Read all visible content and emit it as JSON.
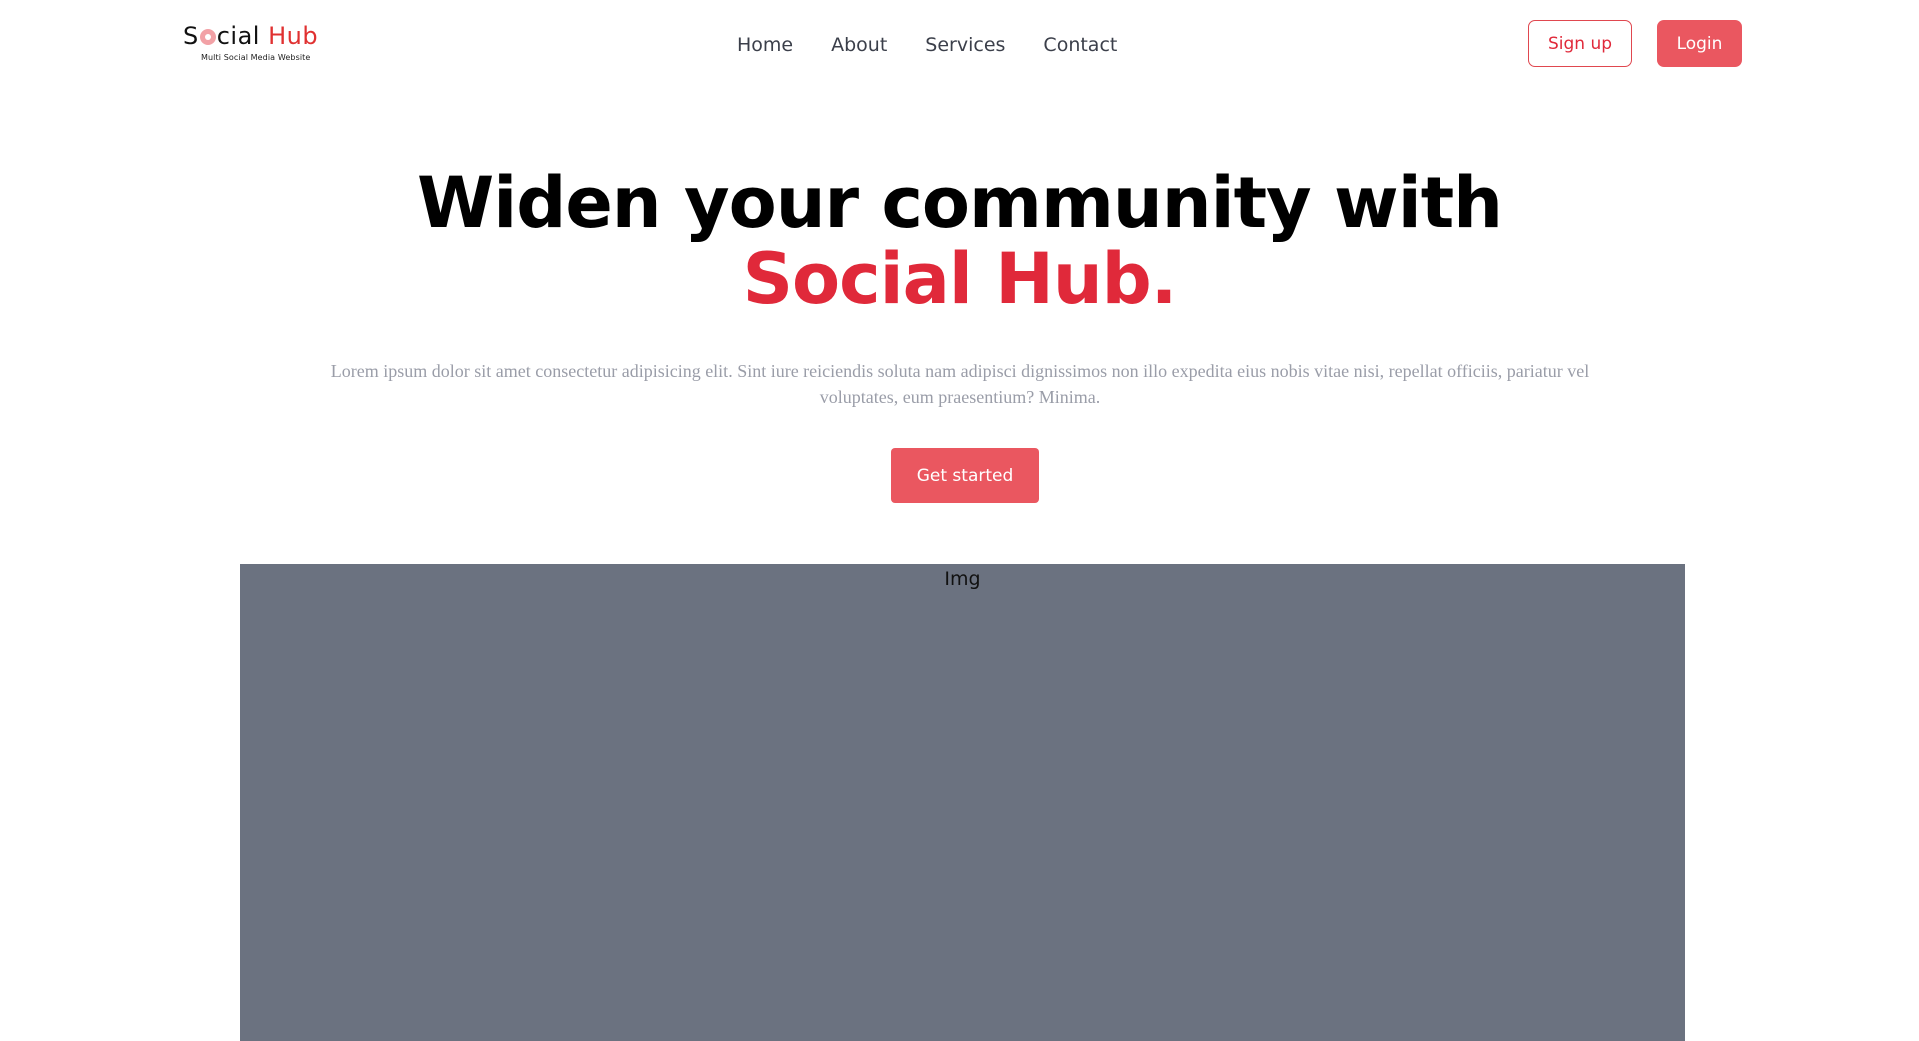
{
  "header": {
    "logo": {
      "text_before_o": "S",
      "text_after_o": "cial",
      "text_red": "Hub",
      "tagline": "Multi Social Media Website"
    },
    "nav": [
      {
        "label": "Home"
      },
      {
        "label": "About"
      },
      {
        "label": "Services"
      },
      {
        "label": "Contact"
      }
    ],
    "signup_label": "Sign up",
    "login_label": "Login"
  },
  "hero": {
    "title_line1": "Widen your community with",
    "title_accent": "Social Hub.",
    "description": "Lorem ipsum dolor sit amet consectetur adipisicing elit. Sint iure reiciendis soluta nam adipisci dignissimos non illo expedita eius nobis vitae nisi, repellat officiis, pariatur vel voluptates, eum praesentium? Minima.",
    "cta_label": "Get started"
  },
  "image_placeholder": {
    "label": "Img"
  },
  "colors": {
    "accent": "#e0293a",
    "button_fill": "#ea5760",
    "placeholder_bg": "#6b7280",
    "muted_text": "#9a9da8"
  }
}
